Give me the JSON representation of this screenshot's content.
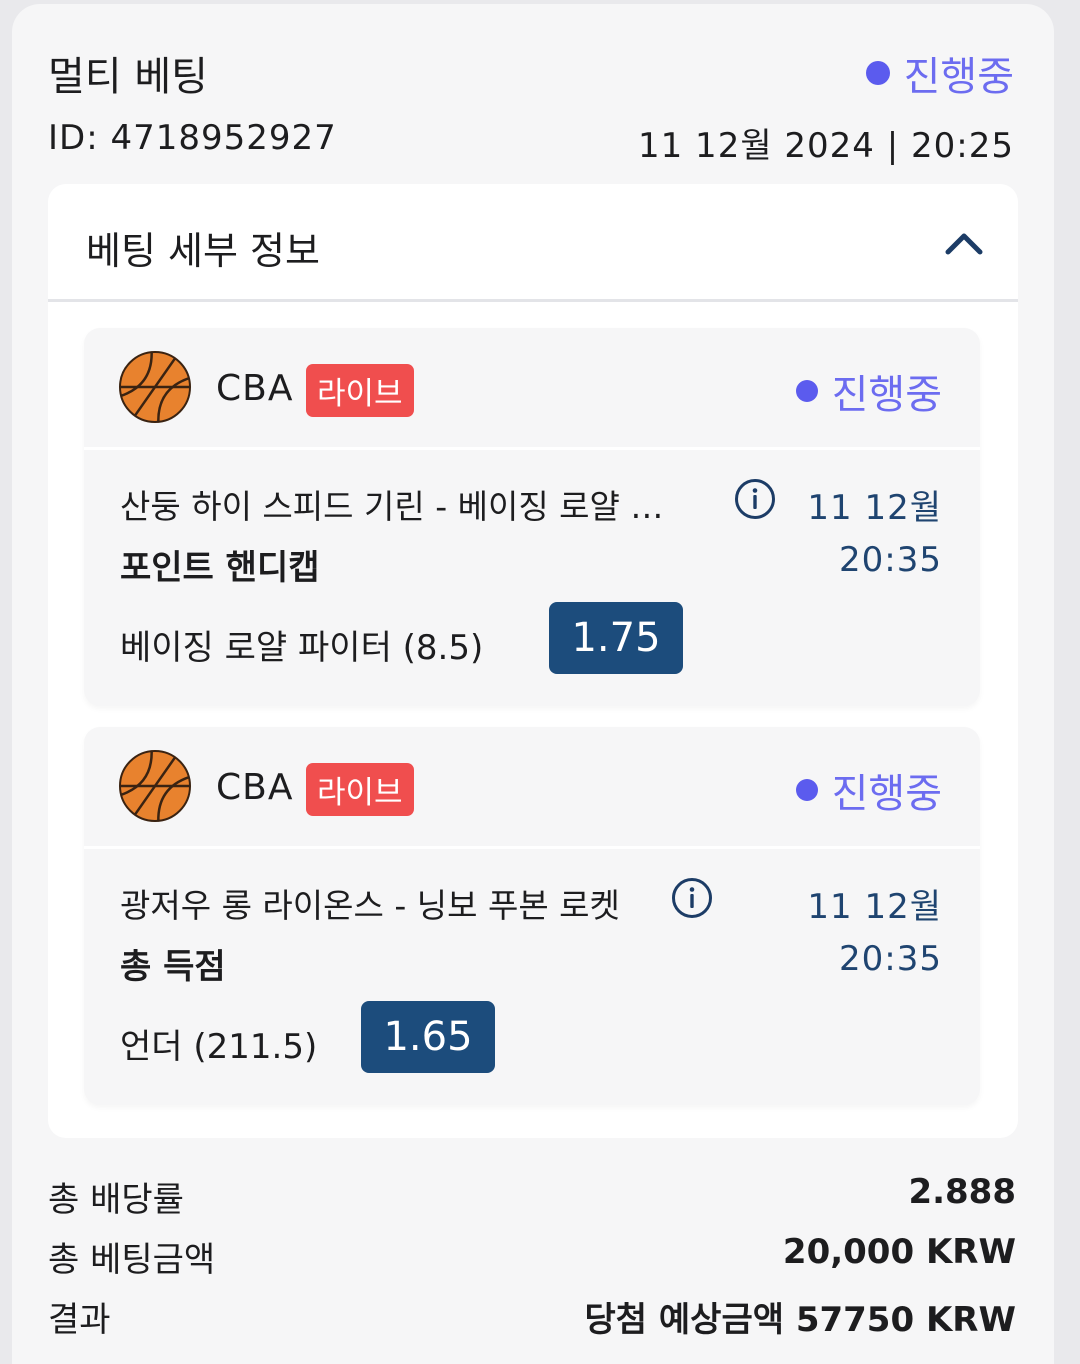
{
  "header": {
    "title": "멀티 베팅",
    "status": "진행중",
    "id_text": "ID: 4718952927",
    "date_text": "11 12월 2024 | 20:25"
  },
  "details": {
    "title": "베팅 세부 정보",
    "bets": [
      {
        "league": "CBA",
        "live": "라이브",
        "status": "진행중",
        "match": "산둥 하이 스피드 기린 - 베이징 로얄 …",
        "market": "포인트 핸디캡",
        "pick": "베이징 로얄 파이터 (8.5)",
        "odds": "1.75",
        "date": "11 12월",
        "time": "20:35"
      },
      {
        "league": "CBA",
        "live": "라이브",
        "status": "진행중",
        "match": "광저우 롱 라이온스 - 닝보 푸본 로켓",
        "market": "총 득점",
        "pick": "언더 (211.5)",
        "odds": "1.65",
        "date": "11 12월",
        "time": "20:35"
      }
    ]
  },
  "summary": {
    "total_odds_label": "총 배당률",
    "total_odds_value": "2.888",
    "total_stake_label": "총 베팅금액",
    "total_stake_value": "20,000 KRW",
    "result_label": "결과",
    "result_value": "당첨 예상금액 57750 KRW"
  },
  "colors": {
    "status": "#6c6cf0",
    "live_badge": "#f04e4e",
    "odds_button": "#1c4c7c",
    "time_text": "#1f4470",
    "basketball": "#e8822e"
  },
  "icons": [
    "basketball-icon",
    "info-icon",
    "chevron-up-icon",
    "status-dot-icon"
  ]
}
